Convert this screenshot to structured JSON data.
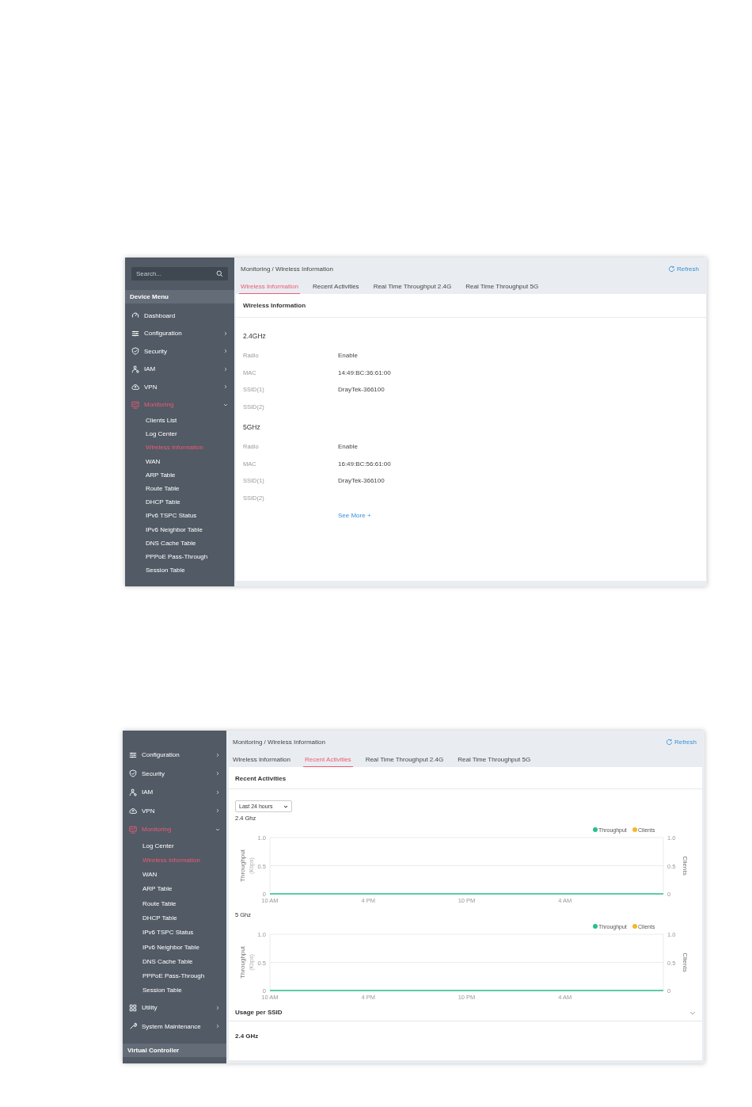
{
  "screenshots": [
    {
      "kind": "info",
      "sidebar": {
        "search": {
          "placeholder": "Search..."
        },
        "header": "Device Menu",
        "items": [
          {
            "label": "Dashboard",
            "expandable": false,
            "selected": false
          },
          {
            "label": "Configuration",
            "expandable": true,
            "expanded": false,
            "selected": false
          },
          {
            "label": "Security",
            "expandable": true,
            "expanded": false,
            "selected": false
          },
          {
            "label": "IAM",
            "expandable": true,
            "expanded": false,
            "selected": false
          },
          {
            "label": "VPN",
            "expandable": true,
            "expanded": false,
            "selected": false
          },
          {
            "label": "Monitoring",
            "expandable": true,
            "expanded": true,
            "selected": true,
            "children": [
              {
                "label": "Clients List",
                "selected": false
              },
              {
                "label": "Log Center",
                "selected": false
              },
              {
                "label": "Wireless Information",
                "selected": true
              },
              {
                "label": "WAN",
                "selected": false
              },
              {
                "label": "ARP Table",
                "selected": false
              },
              {
                "label": "Route Table",
                "selected": false
              },
              {
                "label": "DHCP Table",
                "selected": false
              },
              {
                "label": "IPv6 TSPC Status",
                "selected": false
              },
              {
                "label": "IPv6 Neighbor Table",
                "selected": false
              },
              {
                "label": "DNS Cache Table",
                "selected": false
              },
              {
                "label": "PPPoE Pass-Through",
                "selected": false
              },
              {
                "label": "Session Table",
                "selected": false
              }
            ]
          }
        ]
      },
      "breadcrumb": "Monitoring / Wireless Information",
      "refresh": "Refresh",
      "tabs": [
        {
          "label": "Wireless Information",
          "selected": true
        },
        {
          "label": "Recent Activities",
          "selected": false
        },
        {
          "label": "Real Time Throughput 2.4G",
          "selected": false
        },
        {
          "label": "Real Time Throughput 5G",
          "selected": false
        }
      ],
      "card_title": "Wireless Information",
      "sections": [
        {
          "heading": "2.4GHz",
          "rows": [
            {
              "label": "Radio",
              "value": "Enable"
            },
            {
              "label": "MAC",
              "value": "14:49:BC:36:61:00"
            },
            {
              "label": "SSID(1)",
              "value": "DrayTek-366100"
            },
            {
              "label": "SSID(2)"
            }
          ]
        },
        {
          "heading": "5GHz",
          "rows": [
            {
              "label": "Radio",
              "value": "Enable"
            },
            {
              "label": "MAC",
              "value": "16:49:BC:56:61:00"
            },
            {
              "label": "SSID(1)",
              "value": "DrayTek-366100"
            },
            {
              "label": "SSID(2)"
            }
          ]
        }
      ],
      "see_more": "See More +"
    },
    {
      "kind": "activity",
      "sidebar": {
        "items": [
          {
            "label": "Configuration",
            "expandable": true,
            "expanded": false,
            "selected": false
          },
          {
            "label": "Security",
            "expandable": true,
            "expanded": false,
            "selected": false
          },
          {
            "label": "IAM",
            "expandable": true,
            "expanded": false,
            "selected": false
          },
          {
            "label": "VPN",
            "expandable": true,
            "expanded": false,
            "selected": false
          },
          {
            "label": "Monitoring",
            "expandable": true,
            "expanded": true,
            "selected": true,
            "children": [
              {
                "label": "Log Center",
                "selected": false
              },
              {
                "label": "Wireless Information",
                "selected": true
              },
              {
                "label": "WAN",
                "selected": false
              },
              {
                "label": "ARP Table",
                "selected": false
              },
              {
                "label": "Route Table",
                "selected": false
              },
              {
                "label": "DHCP Table",
                "selected": false
              },
              {
                "label": "IPv6 TSPC Status",
                "selected": false
              },
              {
                "label": "IPv6 Neighbor Table",
                "selected": false
              },
              {
                "label": "DNS Cache Table",
                "selected": false
              },
              {
                "label": "PPPoE Pass-Through",
                "selected": false
              },
              {
                "label": "Session Table",
                "selected": false
              }
            ]
          },
          {
            "label": "Utility",
            "expandable": true,
            "expanded": false,
            "selected": false
          },
          {
            "label": "System Maintenance",
            "expandable": true,
            "expanded": false,
            "selected": false
          }
        ],
        "footer_header": "Virtual Controller"
      },
      "breadcrumb": "Monitoring / Wireless Information",
      "refresh": "Refresh",
      "tabs": [
        {
          "label": "Wireless Information",
          "selected": false
        },
        {
          "label": "Recent Activities",
          "selected": true
        },
        {
          "label": "Real Time Throughput 2.4G",
          "selected": false
        },
        {
          "label": "Real Time Throughput 5G",
          "selected": false
        }
      ],
      "card_title": "Recent Activities",
      "range_select": "Last 24 hours",
      "charts": [
        {
          "title": "2.4 Ghz",
          "unit_label": "(Kbps)",
          "chart_data": {
            "type": "line",
            "ylabel": "Throughput",
            "y2label": "Clients",
            "legend": "top-right",
            "categories": [
              "10 AM",
              "4 PM",
              "10 PM",
              "4 AM",
              null
            ],
            "ylim": [
              0,
              1
            ],
            "yticks": [
              {
                "value": 0,
                "label": "0"
              },
              {
                "value": 0.5,
                "label": "0.5"
              },
              {
                "value": 1,
                "label": "1.0"
              }
            ],
            "series": [
              {
                "name": "Throughput",
                "color": "#2bbf8a",
                "values": [
                  0,
                  0,
                  0,
                  0,
                  0
                ]
              },
              {
                "name": "Clients",
                "color": "#f5b82e",
                "values": [
                  null,
                  null,
                  null,
                  null,
                  null
                ]
              }
            ]
          }
        },
        {
          "title": "5 Ghz",
          "unit_label": "(Kbps)",
          "chart_data": {
            "type": "line",
            "ylabel": "Throughput",
            "y2label": "Clients",
            "legend": "top-right",
            "categories": [
              "10 AM",
              "4 PM",
              "10 PM",
              "4 AM",
              null
            ],
            "ylim": [
              0,
              1
            ],
            "yticks": [
              {
                "value": 0,
                "label": "0"
              },
              {
                "value": 0.5,
                "label": "0.5"
              },
              {
                "value": 1,
                "label": "1.0"
              }
            ],
            "series": [
              {
                "name": "Throughput",
                "color": "#2bbf8a",
                "values": [
                  0,
                  0,
                  0,
                  0,
                  0
                ]
              },
              {
                "name": "Clients",
                "color": "#f5b82e",
                "values": [
                  null,
                  null,
                  null,
                  null,
                  null
                ]
              }
            ]
          }
        }
      ],
      "usage": {
        "title": "Usage per SSID",
        "expanded": true,
        "band": "2.4 GHz"
      }
    }
  ]
}
